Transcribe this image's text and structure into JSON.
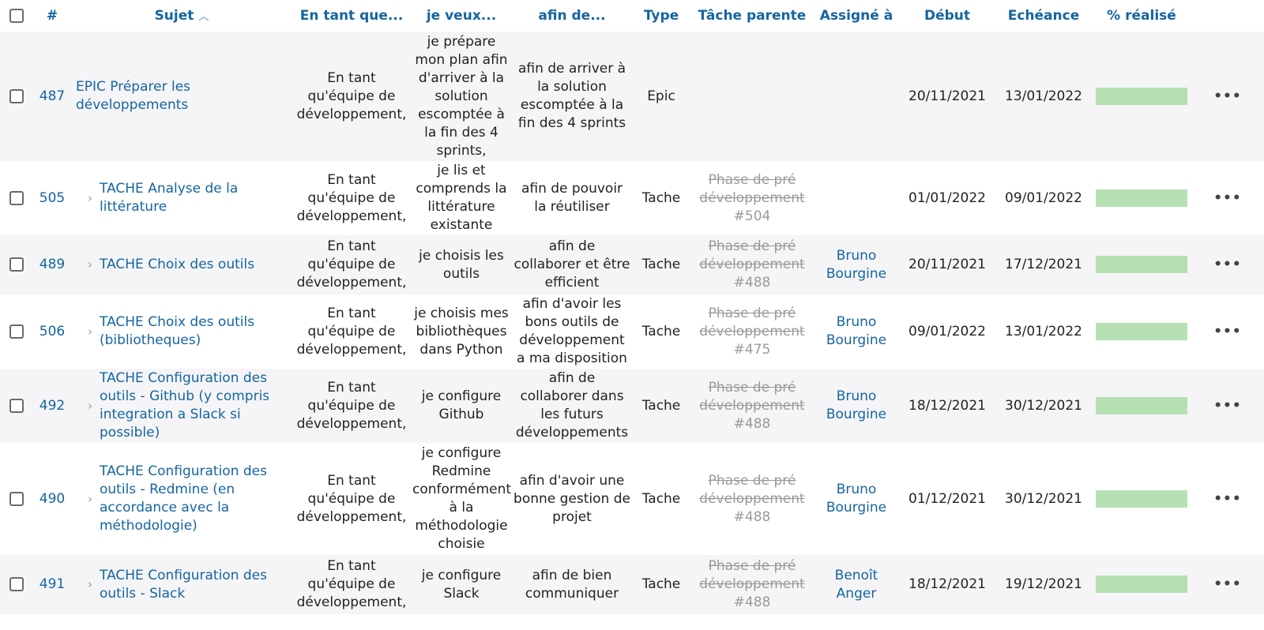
{
  "columns": {
    "id": "#",
    "subject": "Sujet",
    "as_a": "En tant que...",
    "i_want": "je veux...",
    "so_that": "afin de...",
    "type": "Type",
    "parent": "Tâche parente",
    "assignee": "Assigné à",
    "start": "Début",
    "due": "Echéance",
    "done": "% réalisé"
  },
  "rows": [
    {
      "id": "487",
      "subject": "EPIC Préparer les développements",
      "child": false,
      "as_a": "En tant qu'équipe de développement,",
      "i_want": "je prépare mon plan afin d'arriver à la solution escomptée à la fin des 4 sprints,",
      "so_that": "afin de arriver à la solution escomptée à la fin des 4 sprints",
      "type": "Epic",
      "parent_line1": "",
      "parent_line2": "",
      "parent_line3": "",
      "assignee_line1": "",
      "assignee_line2": "",
      "start": "20/11/2021",
      "due": "13/01/2022",
      "done": 1,
      "actions": "•••"
    },
    {
      "id": "505",
      "subject": "TACHE Analyse de la littérature",
      "child": true,
      "as_a": "En tant qu'équipe de développement,",
      "i_want": "je lis et comprends la littérature existante",
      "so_that": "afin de pouvoir la réutiliser",
      "type": "Tache",
      "parent_line1": "Phase de pré",
      "parent_line2": "développement",
      "parent_line3": "#504",
      "assignee_line1": "",
      "assignee_line2": "",
      "start": "01/01/2022",
      "due": "09/01/2022",
      "done": 1,
      "actions": "•••"
    },
    {
      "id": "489",
      "subject": "TACHE Choix des outils",
      "child": true,
      "as_a": "En tant qu'équipe de développement,",
      "i_want": "je choisis les outils",
      "so_that": "afin de collaborer et être efficient",
      "type": "Tache",
      "parent_line1": "Phase de pré",
      "parent_line2": "développement",
      "parent_line3": "#488",
      "assignee_line1": "Bruno",
      "assignee_line2": "Bourgine",
      "start": "20/11/2021",
      "due": "17/12/2021",
      "done": 1,
      "actions": "•••"
    },
    {
      "id": "506",
      "subject": "TACHE Choix des outils (bibliotheques)",
      "child": true,
      "as_a": "En tant qu'équipe de développement,",
      "i_want": "je choisis mes bibliothèques dans Python",
      "so_that": "afin d'avoir les bons outils de développement a ma disposition",
      "type": "Tache",
      "parent_line1": "Phase de pré",
      "parent_line2": "développement",
      "parent_line3": "#475",
      "assignee_line1": "Bruno",
      "assignee_line2": "Bourgine",
      "start": "09/01/2022",
      "due": "13/01/2022",
      "done": 1,
      "actions": "•••"
    },
    {
      "id": "492",
      "subject": "TACHE Configuration des outils - Github (y compris integration a Slack si possible)",
      "child": true,
      "as_a": "En tant qu'équipe de développement,",
      "i_want": "je configure Github",
      "so_that": "afin de collaborer dans les futurs développements",
      "type": "Tache",
      "parent_line1": "Phase de pré",
      "parent_line2": "développement",
      "parent_line3": "#488",
      "assignee_line1": "Bruno",
      "assignee_line2": "Bourgine",
      "start": "18/12/2021",
      "due": "30/12/2021",
      "done": 1,
      "actions": "•••"
    },
    {
      "id": "490",
      "subject": "TACHE Configuration des outils - Redmine (en accordance avec la méthodologie)",
      "child": true,
      "as_a": "En tant qu'équipe de développement,",
      "i_want": "je configure Redmine conformément à la méthodologie choisie",
      "so_that": "afin d'avoir une bonne gestion de projet",
      "type": "Tache",
      "parent_line1": "Phase de pré",
      "parent_line2": "développement",
      "parent_line3": "#488",
      "assignee_line1": "Bruno",
      "assignee_line2": "Bourgine",
      "start": "01/12/2021",
      "due": "30/12/2021",
      "done": 1,
      "actions": "•••"
    },
    {
      "id": "491",
      "subject": "TACHE Configuration des outils - Slack",
      "child": true,
      "as_a": "En tant qu'équipe de développement,",
      "i_want": "je configure Slack",
      "so_that": "afin de bien communiquer",
      "type": "Tache",
      "parent_line1": "Phase de pré",
      "parent_line2": "développement",
      "parent_line3": "#488",
      "assignee_line1": "Benoît",
      "assignee_line2": "Anger",
      "start": "18/12/2021",
      "due": "19/12/2021",
      "done": 1,
      "actions": "•••"
    }
  ],
  "colors": {
    "link": "#1565a0",
    "progress": "#b6e0b3",
    "row_alt": "#f5f5f7"
  }
}
